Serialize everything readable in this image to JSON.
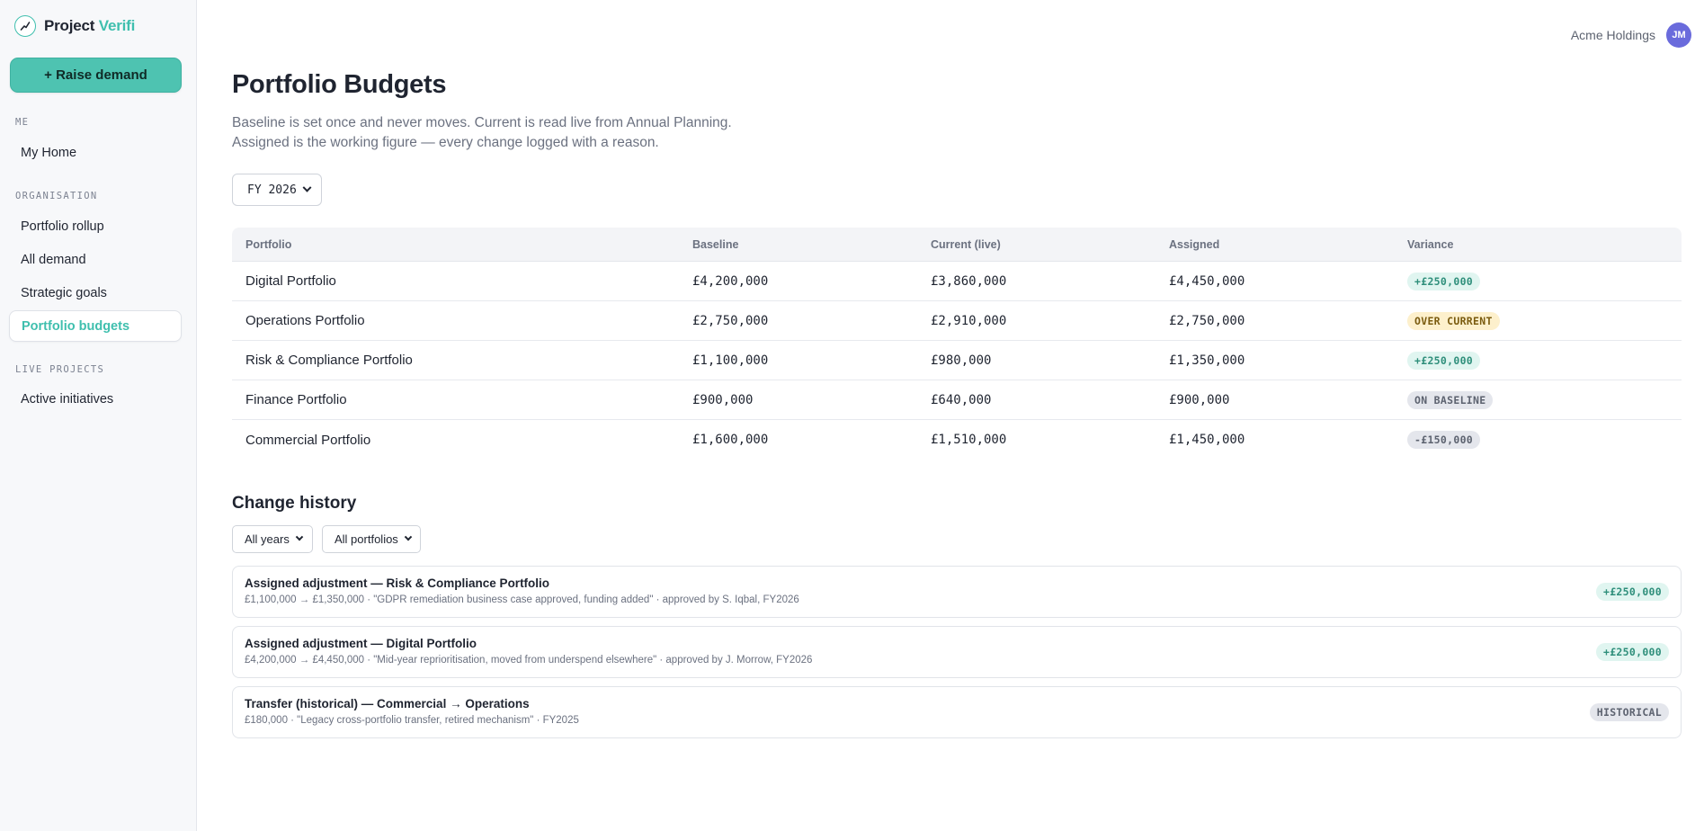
{
  "brand": {
    "name_main": "Project",
    "name_accent": "Verifi"
  },
  "sidebar": {
    "raise_button": "+ Raise demand",
    "sections": [
      {
        "label": "ME",
        "items": [
          {
            "label": "My Home",
            "active": false
          }
        ]
      },
      {
        "label": "ORGANISATION",
        "items": [
          {
            "label": "Portfolio rollup",
            "active": false
          },
          {
            "label": "All demand",
            "active": false
          },
          {
            "label": "Strategic goals",
            "active": false
          },
          {
            "label": "Portfolio budgets",
            "active": true
          }
        ]
      },
      {
        "label": "LIVE PROJECTS",
        "items": [
          {
            "label": "Active initiatives",
            "active": false
          }
        ]
      }
    ]
  },
  "header": {
    "org": "Acme Holdings",
    "avatar_initials": "JM"
  },
  "page": {
    "title": "Portfolio Budgets",
    "description": "Baseline is set once and never moves. Current is read live from Annual Planning. Assigned is the working figure — every change logged with a reason.",
    "fy_select": "FY 2026"
  },
  "table": {
    "columns": [
      "Portfolio",
      "Baseline",
      "Current (live)",
      "Assigned",
      "Variance"
    ],
    "rows": [
      {
        "portfolio": "Digital Portfolio",
        "baseline": "£4,200,000",
        "current": "£3,860,000",
        "assigned": "£4,450,000",
        "variance": "+£250,000",
        "variance_style": "green"
      },
      {
        "portfolio": "Operations Portfolio",
        "baseline": "£2,750,000",
        "current": "£2,910,000",
        "assigned": "£2,750,000",
        "variance": "OVER CURRENT",
        "variance_style": "amber"
      },
      {
        "portfolio": "Risk & Compliance Portfolio",
        "baseline": "£1,100,000",
        "current": "£980,000",
        "assigned": "£1,350,000",
        "variance": "+£250,000",
        "variance_style": "green"
      },
      {
        "portfolio": "Finance Portfolio",
        "baseline": "£900,000",
        "current": "£640,000",
        "assigned": "£900,000",
        "variance": "ON BASELINE",
        "variance_style": "gray"
      },
      {
        "portfolio": "Commercial Portfolio",
        "baseline": "£1,600,000",
        "current": "£1,510,000",
        "assigned": "£1,450,000",
        "variance": "-£150,000",
        "variance_style": "gray"
      }
    ]
  },
  "history": {
    "title": "Change history",
    "filter_years": "All years",
    "filter_portfolios": "All portfolios",
    "items": [
      {
        "title": "Assigned adjustment — Risk & Compliance Portfolio",
        "detail": "£1,100,000 → £1,350,000 · \"GDPR remediation business case approved, funding added\" · approved by S. Iqbal, FY2026",
        "badge": "+£250,000",
        "badge_style": "green"
      },
      {
        "title": "Assigned adjustment — Digital Portfolio",
        "detail": "£4,200,000 → £4,450,000 · \"Mid-year reprioritisation, moved from underspend elsewhere\" · approved by J. Morrow, FY2026",
        "badge": "+£250,000",
        "badge_style": "green"
      },
      {
        "title": "Transfer (historical) — Commercial → Operations",
        "detail": "£180,000 · \"Legacy cross-portfolio transfer, retired mechanism\" · FY2025",
        "badge": "HISTORICAL",
        "badge_style": "gray"
      }
    ]
  },
  "colors": {
    "accent": "#3fbfae",
    "button": "#4ec3b1",
    "avatar": "#6a6bdc"
  },
  "icons": {
    "logo": "chart-trend-icon",
    "chevron": "chevron-down-icon"
  }
}
